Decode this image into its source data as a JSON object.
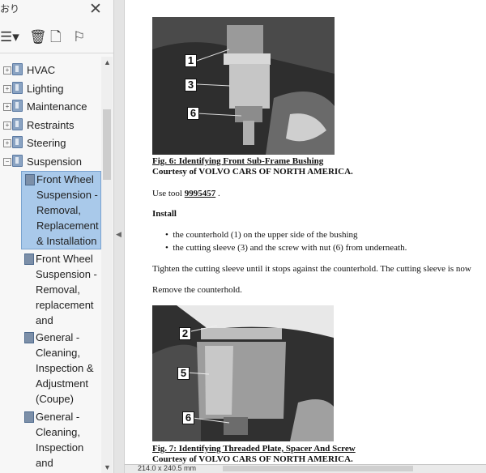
{
  "sidebar": {
    "title": "おり",
    "close_glyph": "✕",
    "toolbar": {
      "options": "☰▾",
      "delete": "🗑",
      "add": "🗋",
      "find": "⚐"
    },
    "tree": [
      {
        "label": "HVAC"
      },
      {
        "label": "Lighting"
      },
      {
        "label": "Maintenance"
      },
      {
        "label": "Restraints"
      },
      {
        "label": "Steering"
      },
      {
        "label": "Suspension"
      }
    ],
    "children": [
      {
        "lines": [
          "Front Wheel",
          "Suspension -",
          "Removal,",
          "Replacement",
          "& Installation"
        ],
        "selected": true
      },
      {
        "lines": [
          "Front Wheel",
          "Suspension -",
          "Removal,",
          "replacement",
          "and"
        ],
        "selected": false
      },
      {
        "lines": [
          "General -",
          "Cleaning,",
          "Inspection &",
          "Adjustment",
          "(Coupe)"
        ],
        "selected": false
      },
      {
        "lines": [
          "General -",
          "Cleaning,",
          "Inspection",
          "and"
        ],
        "selected": false
      }
    ]
  },
  "document": {
    "fig6": {
      "callouts": [
        "1",
        "3",
        "6"
      ],
      "caption": "Fig. 6: Identifying Front Sub-Frame Bushing",
      "courtesy": "Courtesy of VOLVO CARS OF NORTH AMERICA."
    },
    "use_tool_prefix": "Use tool ",
    "tool_number": "9995457",
    "use_tool_suffix": " .",
    "install_heading": "Install",
    "bullets": [
      "the counterhold (1) on the upper side of the bushing",
      "the cutting sleeve (3) and the screw with nut (6) from underneath."
    ],
    "para1": "Tighten the cutting sleeve until it stops against the counterhold. The cutting sleeve is now",
    "para2": "Remove the counterhold.",
    "fig7": {
      "callouts": [
        "2",
        "5",
        "6"
      ],
      "caption": "Fig. 7: Identifying Threaded Plate, Spacer And Screw",
      "courtesy": "Courtesy of VOLVO CARS OF NORTH AMERICA."
    }
  },
  "status": {
    "page_size": "214.0 x 240.5 mm"
  }
}
